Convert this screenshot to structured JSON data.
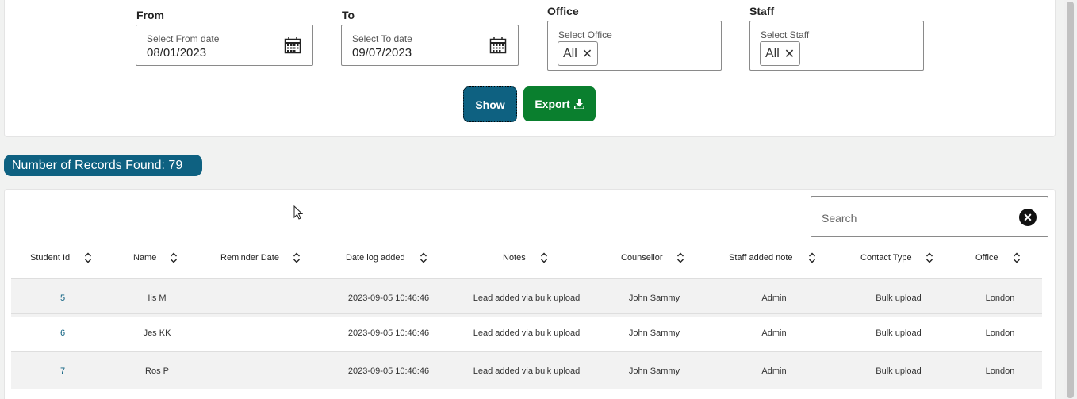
{
  "filters": {
    "from": {
      "label": "From",
      "sub": "Select From date",
      "value": "08/01/2023"
    },
    "to": {
      "label": "To",
      "sub": "Select To date",
      "value": "09/07/2023"
    },
    "office": {
      "label": "Office",
      "sub": "Select Office",
      "chip": "All"
    },
    "staff": {
      "label": "Staff",
      "sub": "Select Staff",
      "chip": "All"
    }
  },
  "buttons": {
    "show": "Show",
    "export": "Export"
  },
  "records_label": "Number of Records Found: 79",
  "search": {
    "placeholder": "Search"
  },
  "columns": [
    "Student Id",
    "Name",
    "Reminder Date",
    "Date log added",
    "Notes",
    "Counsellor",
    "Staff added note",
    "Contact Type",
    "Office"
  ],
  "rows": [
    {
      "id": "5",
      "name": "Iis M",
      "reminder": "",
      "date": "2023-09-05 10:46:46",
      "notes": "Lead added via bulk upload",
      "counsellor": "John Sammy",
      "staff": "Admin",
      "contact": "Bulk upload",
      "office": "London"
    },
    {
      "id": "6",
      "name": "Jes KK",
      "reminder": "",
      "date": "2023-09-05 10:46:46",
      "notes": "Lead added via bulk upload",
      "counsellor": "John Sammy",
      "staff": "Admin",
      "contact": "Bulk upload",
      "office": "London"
    },
    {
      "id": "7",
      "name": "Ros P",
      "reminder": "",
      "date": "2023-09-05 10:46:46",
      "notes": "Lead added via bulk upload",
      "counsellor": "John Sammy",
      "staff": "Admin",
      "contact": "Bulk upload",
      "office": "London"
    }
  ],
  "colors": {
    "primary": "#0e6181",
    "export": "#0a7f2e"
  }
}
